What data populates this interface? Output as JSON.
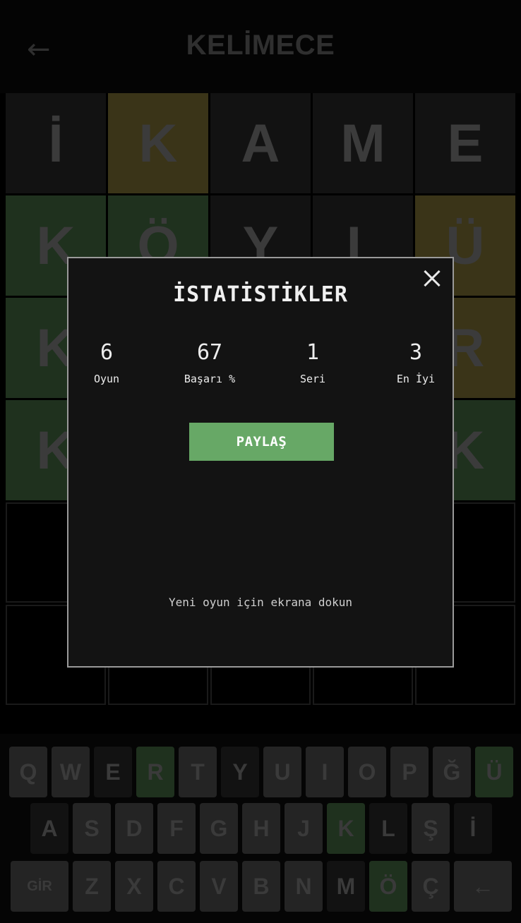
{
  "header": {
    "back_icon": "arrow-left-icon",
    "back_glyph": "←",
    "title": "KELİMECE"
  },
  "board": {
    "rows": [
      [
        {
          "l": "İ",
          "s": "absent"
        },
        {
          "l": "K",
          "s": "present"
        },
        {
          "l": "A",
          "s": "absent"
        },
        {
          "l": "M",
          "s": "absent"
        },
        {
          "l": "E",
          "s": "absent"
        }
      ],
      [
        {
          "l": "K",
          "s": "correct"
        },
        {
          "l": "Ö",
          "s": "correct"
        },
        {
          "l": "Y",
          "s": "absent"
        },
        {
          "l": "L",
          "s": "absent"
        },
        {
          "l": "Ü",
          "s": "present"
        }
      ],
      [
        {
          "l": "K",
          "s": "correct"
        },
        {
          "l": "",
          "s": "absent"
        },
        {
          "l": "",
          "s": "absent"
        },
        {
          "l": "",
          "s": "absent"
        },
        {
          "l": "R",
          "s": "present"
        }
      ],
      [
        {
          "l": "K",
          "s": "correct"
        },
        {
          "l": "",
          "s": "correct"
        },
        {
          "l": "",
          "s": "correct"
        },
        {
          "l": "",
          "s": "correct"
        },
        {
          "l": "K",
          "s": "correct"
        }
      ],
      [
        {
          "l": "",
          "s": "empty"
        },
        {
          "l": "",
          "s": "empty"
        },
        {
          "l": "",
          "s": "empty"
        },
        {
          "l": "",
          "s": "empty"
        },
        {
          "l": "",
          "s": "empty"
        }
      ],
      [
        {
          "l": "",
          "s": "empty"
        },
        {
          "l": "",
          "s": "empty"
        },
        {
          "l": "",
          "s": "empty"
        },
        {
          "l": "",
          "s": "empty"
        },
        {
          "l": "",
          "s": "empty"
        }
      ]
    ]
  },
  "keyboard": {
    "rows": [
      [
        {
          "k": "Q",
          "s": "default"
        },
        {
          "k": "W",
          "s": "default"
        },
        {
          "k": "E",
          "s": "absent"
        },
        {
          "k": "R",
          "s": "correct"
        },
        {
          "k": "T",
          "s": "default"
        },
        {
          "k": "Y",
          "s": "absent"
        },
        {
          "k": "U",
          "s": "default"
        },
        {
          "k": "I",
          "s": "default"
        },
        {
          "k": "O",
          "s": "default"
        },
        {
          "k": "P",
          "s": "default"
        },
        {
          "k": "Ğ",
          "s": "default"
        },
        {
          "k": "Ü",
          "s": "correct"
        }
      ],
      [
        {
          "k": "A",
          "s": "absent"
        },
        {
          "k": "S",
          "s": "default"
        },
        {
          "k": "D",
          "s": "default"
        },
        {
          "k": "F",
          "s": "default"
        },
        {
          "k": "G",
          "s": "default"
        },
        {
          "k": "H",
          "s": "default"
        },
        {
          "k": "J",
          "s": "default"
        },
        {
          "k": "K",
          "s": "correct"
        },
        {
          "k": "L",
          "s": "absent"
        },
        {
          "k": "Ş",
          "s": "default"
        },
        {
          "k": "İ",
          "s": "absent"
        }
      ],
      [
        {
          "k": "GİR",
          "s": "default",
          "wide": true
        },
        {
          "k": "Z",
          "s": "default"
        },
        {
          "k": "X",
          "s": "default"
        },
        {
          "k": "C",
          "s": "default"
        },
        {
          "k": "V",
          "s": "default"
        },
        {
          "k": "B",
          "s": "default"
        },
        {
          "k": "N",
          "s": "default"
        },
        {
          "k": "M",
          "s": "absent"
        },
        {
          "k": "Ö",
          "s": "correct"
        },
        {
          "k": "Ç",
          "s": "default"
        },
        {
          "k": "←",
          "s": "default",
          "wide": true
        }
      ]
    ]
  },
  "stats_modal": {
    "title": "İSTATİSTİKLER",
    "close_icon": "close-icon",
    "stats": [
      {
        "value": "6",
        "label": "Oyun"
      },
      {
        "value": "67",
        "label": "Başarı %"
      },
      {
        "value": "1",
        "label": "Seri"
      },
      {
        "value": "3",
        "label": "En İyi"
      }
    ],
    "share_label": "PAYLAŞ",
    "hint": "Yeni oyun için ekrana dokun"
  },
  "colors": {
    "correct": "#1f311e",
    "present": "#3a3418",
    "absent": "#121212",
    "share_button": "#67a866"
  }
}
